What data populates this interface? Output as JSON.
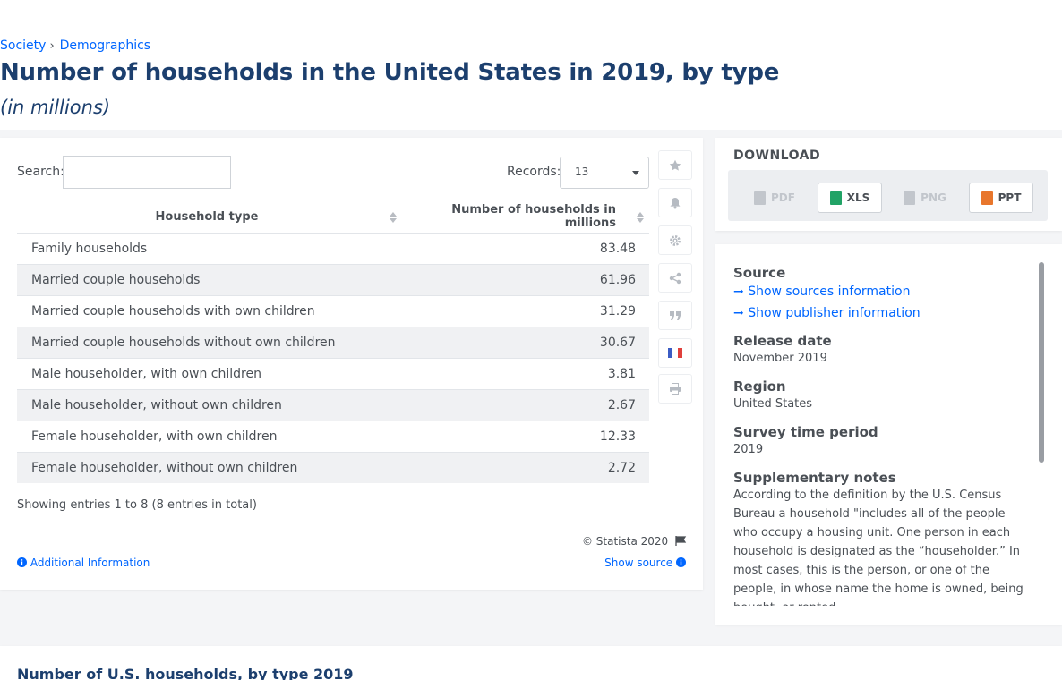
{
  "breadcrumb": {
    "items": [
      "Society",
      "Demographics"
    ],
    "separator": "›"
  },
  "page": {
    "title": "Number of households in the United States in 2019, by type",
    "subtitle": "(in millions)"
  },
  "table_controls": {
    "search_label": "Search:",
    "search_value": "",
    "records_label": "Records:",
    "records_value": "13"
  },
  "table": {
    "headers": [
      "Household type",
      "Number of households in millions"
    ],
    "rows": [
      [
        "Family households",
        "83.48"
      ],
      [
        "Married couple households",
        "61.96"
      ],
      [
        "Married couple households with own children",
        "31.29"
      ],
      [
        "Married couple households without own children",
        "30.67"
      ],
      [
        "Male householder, with own children",
        "3.81"
      ],
      [
        "Male householder, without own children",
        "2.67"
      ],
      [
        "Female householder, with own children",
        "12.33"
      ],
      [
        "Female householder, without own children",
        "2.72"
      ]
    ],
    "showing": "Showing entries 1 to 8 (8 entries in total)"
  },
  "footer": {
    "copyright": "© Statista 2020",
    "additional_info": "Additional Information",
    "show_source": "Show source"
  },
  "sidebar_tools": [
    "star-icon",
    "bell-icon",
    "gear-icon",
    "share-icon",
    "quote-icon",
    "french-flag-icon",
    "print-icon"
  ],
  "download": {
    "title": "DOWNLOAD",
    "buttons": [
      {
        "label": "PDF",
        "enabled": false,
        "color": "#c2c6cc"
      },
      {
        "label": "XLS",
        "enabled": true,
        "color": "#21a366"
      },
      {
        "label": "PNG",
        "enabled": false,
        "color": "#c2c6cc"
      },
      {
        "label": "PPT",
        "enabled": true,
        "color": "#e8762c"
      }
    ]
  },
  "info": {
    "source_title": "Source",
    "show_sources": "Show sources information",
    "show_publisher": "Show publisher information",
    "release_title": "Release date",
    "release_value": "November 2019",
    "region_title": "Region",
    "region_value": "United States",
    "survey_title": "Survey time period",
    "survey_value": "2019",
    "supp_title": "Supplementary notes",
    "supp_text": "According to the definition by the U.S. Census Bureau a household \"includes all of the people who occupy a housing unit. One person in each household is designated as the “householder.” In most cases, this is the person, or one of the people, in whose name the home is owned, being bought, or rented."
  },
  "bottom": {
    "title": "Number of U.S. households, by type 2019"
  },
  "colors": {
    "link": "#0066ff",
    "title": "#1c3f6e",
    "text": "#4a4f55"
  }
}
